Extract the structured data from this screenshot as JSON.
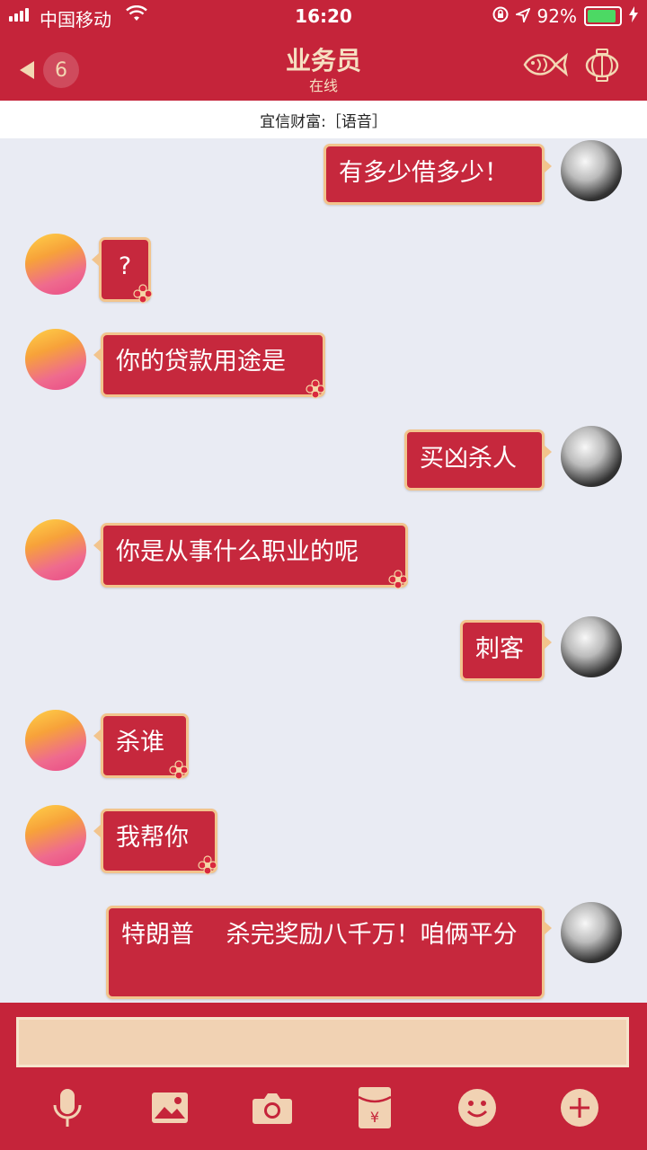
{
  "status_bar": {
    "carrier": "中国移动",
    "time": "16:20",
    "battery": "92%",
    "battery_level": 0.92
  },
  "header": {
    "unread_count": "6",
    "title": "业务员",
    "subtitle": "在线"
  },
  "notice": "宜信财富:［语音］",
  "messages": [
    {
      "from": "self",
      "text": "有多少借多少！"
    },
    {
      "from": "agent",
      "text": "?"
    },
    {
      "from": "agent",
      "text": "你的贷款用途是"
    },
    {
      "from": "self",
      "text": "买凶杀人"
    },
    {
      "from": "agent",
      "text": "你是从事什么职业的呢"
    },
    {
      "from": "self",
      "text": "刺客"
    },
    {
      "from": "agent",
      "text": "杀谁"
    },
    {
      "from": "agent",
      "text": "我帮你"
    },
    {
      "from": "self",
      "text": "特朗普　 杀完奖励八千万！咱俩平分"
    }
  ],
  "toolbar": {
    "icons": [
      "microphone-icon",
      "image-icon",
      "camera-icon",
      "red-packet-icon",
      "emoji-icon",
      "plus-icon"
    ],
    "red_packet_symbol": "¥"
  },
  "colors": {
    "theme_red": "#c5243a",
    "bubble_red": "#c6283d",
    "bubble_border": "#f2c48d",
    "chat_bg": "#e9ebf3",
    "input_bg": "#f1d2b3"
  }
}
